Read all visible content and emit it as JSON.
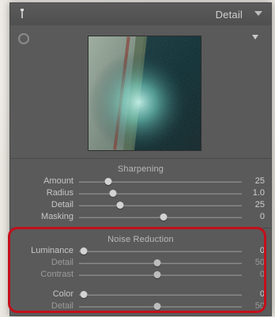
{
  "panel": {
    "title": "Detail",
    "icons": {
      "panel_left": "panel-handle-icon",
      "panel_disclosure": "panel-disclosure-triangle-icon",
      "target": "target-adjustment-icon",
      "preview_disclosure": "preview-disclosure-triangle-icon"
    }
  },
  "preview": {
    "name": "detail-preview-image"
  },
  "sharpening": {
    "title": "Sharpening",
    "sliders": [
      {
        "label": "Amount",
        "value": "25",
        "position": 0.18,
        "accent": true
      },
      {
        "label": "Radius",
        "value": "1.0",
        "position": 0.21,
        "accent": false
      },
      {
        "label": "Detail",
        "value": "25",
        "position": 0.25,
        "accent": false
      },
      {
        "label": "Masking",
        "value": "0",
        "position": 0.52,
        "accent": false
      }
    ]
  },
  "noise_reduction": {
    "title": "Noise Reduction",
    "sliders": [
      {
        "label": "Luminance",
        "value": "0",
        "position": 0.03,
        "dimmed": false
      },
      {
        "label": "Detail",
        "value": "50",
        "position": 0.48,
        "dimmed": true
      },
      {
        "label": "Contrast",
        "value": "0",
        "position": 0.48,
        "dimmed": true
      },
      {
        "label": "Color",
        "value": "0",
        "position": 0.03,
        "dimmed": false
      },
      {
        "label": "Detail",
        "value": "50",
        "position": 0.48,
        "dimmed": true
      }
    ]
  },
  "colors": {
    "accent": "#8b2f38",
    "highlight": "#c40f1a",
    "panel": "#5a5a5a"
  }
}
